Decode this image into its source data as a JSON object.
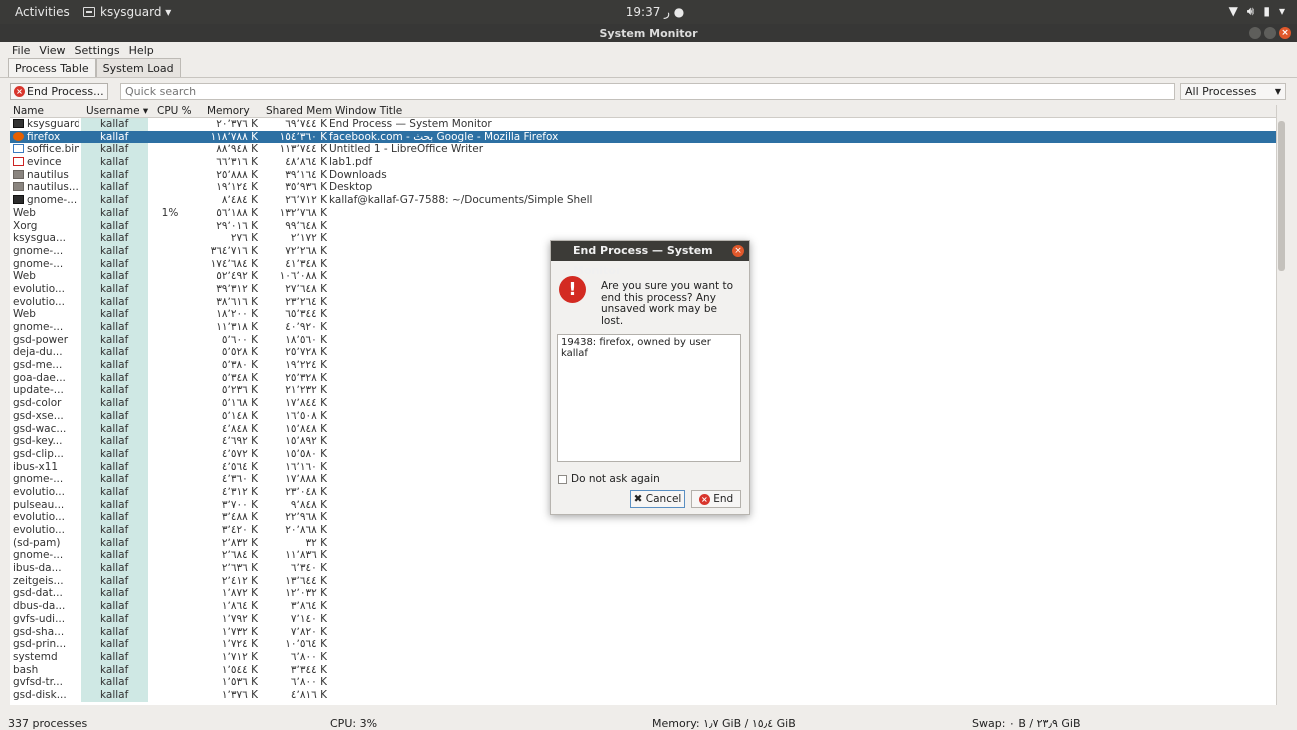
{
  "top_panel": {
    "activities": "Activities",
    "app_name": "ksysguard ▾",
    "clock": "19:37 ر ●",
    "tray_icons": [
      "wifi-icon",
      "volume-icon",
      "battery-icon",
      "power-menu-icon"
    ]
  },
  "window": {
    "title": "System Monitor",
    "menu": [
      "File",
      "View",
      "Settings",
      "Help"
    ],
    "tabs": [
      "Process Table",
      "System Load"
    ],
    "end_process_label": "End Process...",
    "search_placeholder": "Quick search",
    "filter_value": "All Processes"
  },
  "table": {
    "columns": [
      "Name",
      "Username ▾",
      "CPU %",
      "Memory",
      "Shared Mem",
      "Window Title"
    ],
    "rows": [
      {
        "name": "ksysguard",
        "user": "kallaf",
        "cpu": "",
        "mem": "٢٠٬٣٧٦ K",
        "shr": "٦٩٬٧٤٤ K",
        "title": "End Process — System Monitor",
        "icon": "monitor-icon"
      },
      {
        "name": "firefox",
        "user": "kallaf",
        "cpu": "",
        "mem": "١١٨٬٧٨٨ K",
        "shr": "١٥٤٬٣٦٠ K",
        "title": "facebook.com - بحث Google - Mozilla Firefox",
        "icon": "firefox-icon",
        "selected": true
      },
      {
        "name": "soffice.bin",
        "user": "kallaf",
        "cpu": "",
        "mem": "٨٨٬٩٤٨ K",
        "shr": "١١٣٬٧٤٤ K",
        "title": "Untitled 1 - LibreOffice Writer",
        "icon": "document-icon"
      },
      {
        "name": "evince",
        "user": "kallaf",
        "cpu": "",
        "mem": "٦٦٬٣١٦ K",
        "shr": "٤٨٬٨٦٤ K",
        "title": "lab1.pdf",
        "icon": "pdf-icon"
      },
      {
        "name": "nautilus",
        "user": "kallaf",
        "cpu": "",
        "mem": "٢٥٬٨٨٨ K",
        "shr": "٣٩٬١٦٤ K",
        "title": "Downloads",
        "icon": "folder-icon"
      },
      {
        "name": "nautilus...",
        "user": "kallaf",
        "cpu": "",
        "mem": "١٩٬١٢٤ K",
        "shr": "٣٥٬٩٣٦ K",
        "title": "Desktop",
        "icon": "folder-icon"
      },
      {
        "name": "gnome-...",
        "user": "kallaf",
        "cpu": "",
        "mem": "٨٬٤٨٤ K",
        "shr": "٢٦٬٧١٢ K",
        "title": "kallaf@kallaf-G7-7588: ~/Documents/Simple Shell",
        "icon": "terminal-icon"
      },
      {
        "name": "Web",
        "user": "kallaf",
        "cpu": "1%",
        "mem": "٥٦٬١٨٨ K",
        "shr": "١٣٢٬٧٦٨ K",
        "title": ""
      },
      {
        "name": "Xorg",
        "user": "kallaf",
        "cpu": "",
        "mem": "٢٩٬٠١٦ K",
        "shr": "٩٩٬٦٤٨ K",
        "title": ""
      },
      {
        "name": "ksysgua...",
        "user": "kallaf",
        "cpu": "",
        "mem": "٢٧٦ K",
        "shr": "٢٬١٧٢ K",
        "title": ""
      },
      {
        "name": "gnome-...",
        "user": "kallaf",
        "cpu": "",
        "mem": "٣٦٤٬٧١٦ K",
        "shr": "٧٢٬٢٦٨ K",
        "title": ""
      },
      {
        "name": "gnome-...",
        "user": "kallaf",
        "cpu": "",
        "mem": "١٧٤٬٦٨٤ K",
        "shr": "٤١٬٣٤٨ K",
        "title": ""
      },
      {
        "name": "Web",
        "user": "kallaf",
        "cpu": "",
        "mem": "٥٢٬٤٩٢ K",
        "shr": "١٠٦٬٠٨٨ K",
        "title": ""
      },
      {
        "name": "evolutio...",
        "user": "kallaf",
        "cpu": "",
        "mem": "٣٩٬٣١٢ K",
        "shr": "٢٧٬٦٤٨ K",
        "title": ""
      },
      {
        "name": "evolutio...",
        "user": "kallaf",
        "cpu": "",
        "mem": "٣٨٬٦١٦ K",
        "shr": "٢٣٬٢٦٤ K",
        "title": ""
      },
      {
        "name": "Web",
        "user": "kallaf",
        "cpu": "",
        "mem": "١٨٬٢٠٠ K",
        "shr": "٦٥٬٣٤٤ K",
        "title": ""
      },
      {
        "name": "gnome-...",
        "user": "kallaf",
        "cpu": "",
        "mem": "١١٬٣١٨ K",
        "shr": "٤٠٬٩٢٠ K",
        "title": ""
      },
      {
        "name": "gsd-power",
        "user": "kallaf",
        "cpu": "",
        "mem": "٥٬٦٠٠ K",
        "shr": "١٨٬٥٦٠ K",
        "title": ""
      },
      {
        "name": "deja-du...",
        "user": "kallaf",
        "cpu": "",
        "mem": "٥٬٥٢٨ K",
        "shr": "٢٥٬٧٢٨ K",
        "title": ""
      },
      {
        "name": "gsd-me...",
        "user": "kallaf",
        "cpu": "",
        "mem": "٥٬٣٨٠ K",
        "shr": "١٩٬٢٢٤ K",
        "title": ""
      },
      {
        "name": "goa-dae...",
        "user": "kallaf",
        "cpu": "",
        "mem": "٥٬٣٤٨ K",
        "shr": "٢٥٬٣٢٨ K",
        "title": ""
      },
      {
        "name": "update-...",
        "user": "kallaf",
        "cpu": "",
        "mem": "٥٬٢٣٦ K",
        "shr": "٢١٬٢٣٢ K",
        "title": ""
      },
      {
        "name": "gsd-color",
        "user": "kallaf",
        "cpu": "",
        "mem": "٥٬١٦٨ K",
        "shr": "١٧٬٨٤٤ K",
        "title": ""
      },
      {
        "name": "gsd-xse...",
        "user": "kallaf",
        "cpu": "",
        "mem": "٥٬١٤٨ K",
        "shr": "١٦٬٥٠٨ K",
        "title": ""
      },
      {
        "name": "gsd-wac...",
        "user": "kallaf",
        "cpu": "",
        "mem": "٤٬٨٤٨ K",
        "shr": "١٥٬٨٤٨ K",
        "title": ""
      },
      {
        "name": "gsd-key...",
        "user": "kallaf",
        "cpu": "",
        "mem": "٤٬٦٩٢ K",
        "shr": "١٥٬٨٩٢ K",
        "title": ""
      },
      {
        "name": "gsd-clip...",
        "user": "kallaf",
        "cpu": "",
        "mem": "٤٬٥٧٢ K",
        "shr": "١٥٬٥٨٠ K",
        "title": ""
      },
      {
        "name": "ibus-x11",
        "user": "kallaf",
        "cpu": "",
        "mem": "٤٬٥٦٤ K",
        "shr": "١٦٬١٦٠ K",
        "title": ""
      },
      {
        "name": "gnome-...",
        "user": "kallaf",
        "cpu": "",
        "mem": "٤٬٣٦٠ K",
        "shr": "١٧٬٨٨٨ K",
        "title": ""
      },
      {
        "name": "evolutio...",
        "user": "kallaf",
        "cpu": "",
        "mem": "٤٬٣١٢ K",
        "shr": "٢٣٬٠٤٨ K",
        "title": ""
      },
      {
        "name": "pulseau...",
        "user": "kallaf",
        "cpu": "",
        "mem": "٣٬٧٠٠ K",
        "shr": "٩٬٨٤٨ K",
        "title": ""
      },
      {
        "name": "evolutio...",
        "user": "kallaf",
        "cpu": "",
        "mem": "٣٬٤٨٨ K",
        "shr": "٢٢٬٩٦٨ K",
        "title": ""
      },
      {
        "name": "evolutio...",
        "user": "kallaf",
        "cpu": "",
        "mem": "٣٬٤٢٠ K",
        "shr": "٢٠٬٨٦٨ K",
        "title": ""
      },
      {
        "name": "(sd-pam)",
        "user": "kallaf",
        "cpu": "",
        "mem": "٢٬٨٣٢ K",
        "shr": "٣٢ K",
        "title": ""
      },
      {
        "name": "gnome-...",
        "user": "kallaf",
        "cpu": "",
        "mem": "٢٬٦٨٤ K",
        "shr": "١١٬٨٣٦ K",
        "title": ""
      },
      {
        "name": "ibus-da...",
        "user": "kallaf",
        "cpu": "",
        "mem": "٢٬٦٣٦ K",
        "shr": "٦٬٣٤٠ K",
        "title": ""
      },
      {
        "name": "zeitgeis...",
        "user": "kallaf",
        "cpu": "",
        "mem": "٢٬٤١٢ K",
        "shr": "١٣٬٦٤٤ K",
        "title": ""
      },
      {
        "name": "gsd-dat...",
        "user": "kallaf",
        "cpu": "",
        "mem": "١٬٨٧٢ K",
        "shr": "١٢٬٠٣٢ K",
        "title": ""
      },
      {
        "name": "dbus-da...",
        "user": "kallaf",
        "cpu": "",
        "mem": "١٬٨٦٤ K",
        "shr": "٣٬٨٦٤ K",
        "title": ""
      },
      {
        "name": "gvfs-udi...",
        "user": "kallaf",
        "cpu": "",
        "mem": "١٬٧٩٢ K",
        "shr": "٧٬١٤٠ K",
        "title": ""
      },
      {
        "name": "gsd-sha...",
        "user": "kallaf",
        "cpu": "",
        "mem": "١٬٧٣٢ K",
        "shr": "٧٬٨٢٠ K",
        "title": ""
      },
      {
        "name": "gsd-prin...",
        "user": "kallaf",
        "cpu": "",
        "mem": "١٬٧٢٤ K",
        "shr": "١٠٬٥٦٤ K",
        "title": ""
      },
      {
        "name": "systemd",
        "user": "kallaf",
        "cpu": "",
        "mem": "١٬٧١٢ K",
        "shr": "٦٬٨٠٠ K",
        "title": ""
      },
      {
        "name": "bash",
        "user": "kallaf",
        "cpu": "",
        "mem": "١٬٥٤٤ K",
        "shr": "٣٬٣٤٤ K",
        "title": ""
      },
      {
        "name": "gvfsd-tr...",
        "user": "kallaf",
        "cpu": "",
        "mem": "١٬٥٣٦ K",
        "shr": "٦٬٨٠٠ K",
        "title": ""
      },
      {
        "name": "gsd-disk...",
        "user": "kallaf",
        "cpu": "",
        "mem": "١٬٣٧٦ K",
        "shr": "٤٬٨١٦ K",
        "title": ""
      }
    ]
  },
  "status": {
    "processes": "337 processes",
    "cpu": "CPU: 3%",
    "memory": "Memory: ١٫٧ GiB / ١٥٫٤ GiB",
    "swap": "Swap: ٠ B / ٢٣٫٩ GiB"
  },
  "dialog": {
    "title": "End Process — System Monitor",
    "message": "Are you sure you want to end this process?  Any unsaved work may be lost.",
    "list_item": "19438: firefox, owned by user kallaf",
    "checkbox_label": "Do not ask again",
    "cancel_label": "Cancel",
    "end_label": "End"
  },
  "colors": {
    "selection": "#2d70a3",
    "user_column": "#cfe8e4",
    "dialog_titlebar": "#3c3b37",
    "warning": "#d32b22"
  }
}
